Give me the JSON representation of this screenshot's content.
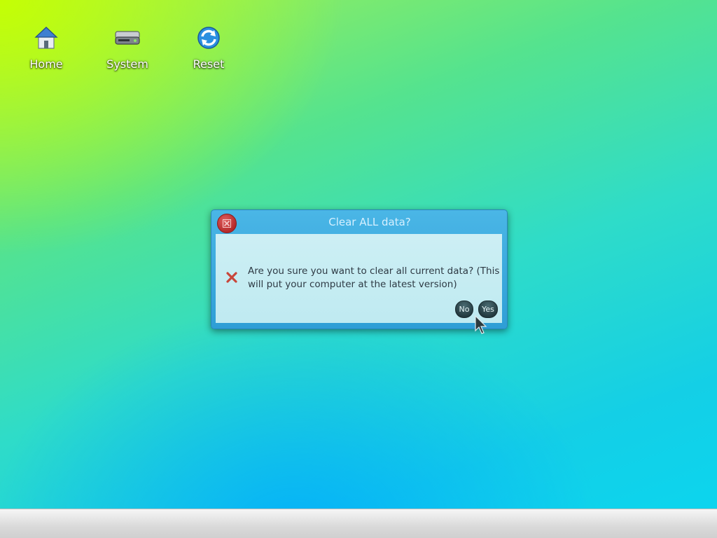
{
  "desktop": {
    "icons": [
      {
        "label": "Home",
        "icon": "home-icon"
      },
      {
        "label": "System",
        "icon": "hard-drive-icon"
      },
      {
        "label": "Reset",
        "icon": "refresh-icon"
      }
    ]
  },
  "dialog": {
    "title": "Clear ALL data?",
    "message": "Are you sure you want to clear all current data? (This will put your computer at the latest version)",
    "icon": "error-x-icon",
    "close_icon": "close-icon",
    "buttons": {
      "no": "No",
      "yes": "Yes"
    }
  },
  "colors": {
    "dialog_titlebar": "#3aa9de",
    "dialog_body": "#c7edf3",
    "button": "#2c454b",
    "close_button": "#c23a3a"
  }
}
